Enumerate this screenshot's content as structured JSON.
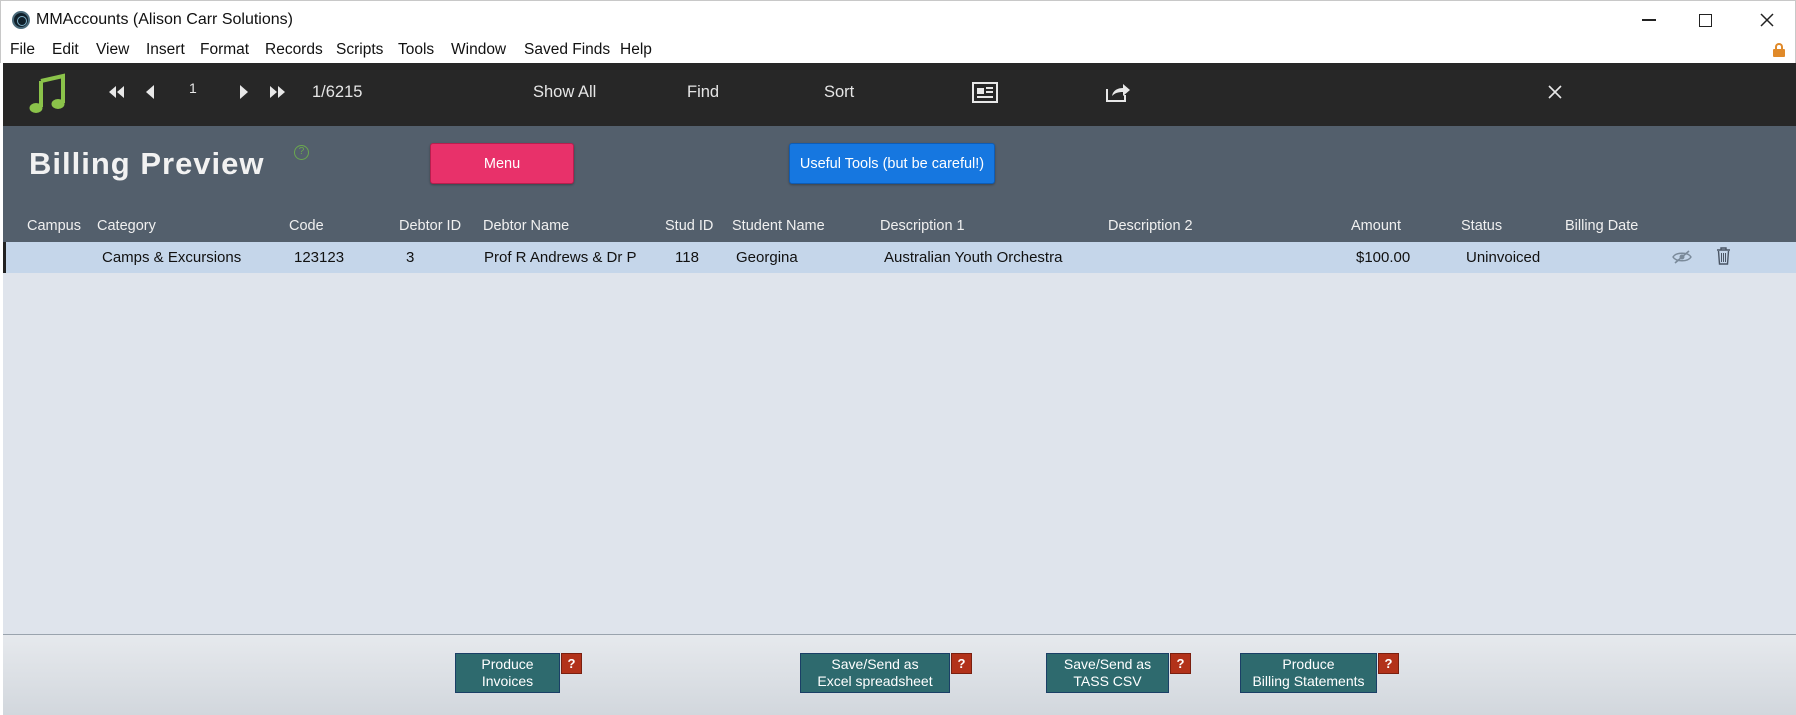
{
  "window": {
    "title": "MMAccounts (Alison Carr Solutions)"
  },
  "menu": [
    "File",
    "Edit",
    "View",
    "Insert",
    "Format",
    "Records",
    "Scripts",
    "Tools",
    "Window",
    "Saved Finds",
    "Help"
  ],
  "toolbar": {
    "record_number": "1",
    "record_count": "1/6215",
    "show_all": "Show All",
    "find": "Find",
    "sort": "Sort"
  },
  "header": {
    "title": "Billing Preview",
    "help_glyph": "?",
    "menu_button": "Menu",
    "tools_button": "Useful Tools (but be careful!)"
  },
  "columns": [
    "Campus",
    "Category",
    "Code",
    "Debtor ID",
    "Debtor Name",
    "Stud ID",
    "Student Name",
    "Description 1",
    "Description 2",
    "Amount",
    "Status",
    "Billing Date"
  ],
  "rows": [
    {
      "campus": "",
      "category": "Camps & Excursions",
      "code": "123123",
      "debtor_id": "3",
      "debtor_name": "Prof R Andrews & Dr P",
      "stud_id": "118",
      "student_name": "Georgina",
      "description_1": "Australian Youth Orchestra",
      "description_2": "",
      "amount": "$100.00",
      "status": "Uninvoiced",
      "billing_date": ""
    }
  ],
  "footer": {
    "buttons": [
      {
        "label": "Produce\nInvoices",
        "help": "?"
      },
      {
        "label": "Save/Send as\nExcel spreadsheet",
        "help": "?"
      },
      {
        "label": "Save/Send as\nTASS CSV",
        "help": "?"
      },
      {
        "label": "Produce\nBilling Statements",
        "help": "?"
      }
    ]
  },
  "colors": {
    "toolbar_bg": "#272727",
    "header_bg": "#535f6c",
    "menu_button": "#e8316a",
    "tools_button": "#1677e0",
    "row_selected": "#c5d6ea",
    "action_button": "#2e6a6e",
    "help_button": "#b2321a",
    "logo_green": "#8bc34a"
  },
  "icons": {
    "logo": "music-note-icon",
    "first": "first-record-icon",
    "prev": "previous-record-icon",
    "next": "next-record-icon",
    "last": "last-record-icon",
    "form_view": "form-view-icon",
    "share": "share-icon",
    "close": "close-icon",
    "omit": "eye-slash-icon",
    "delete": "trash-icon"
  }
}
